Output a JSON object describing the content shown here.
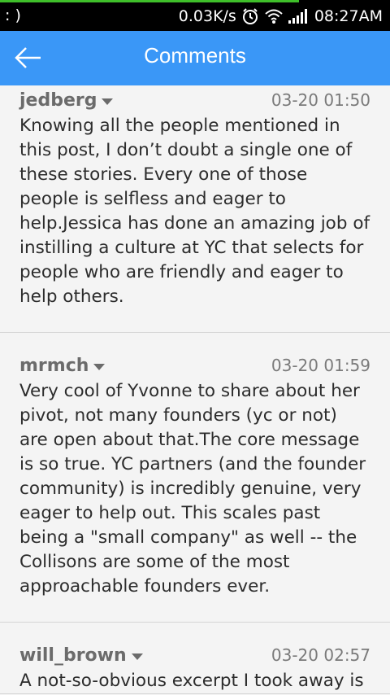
{
  "status": {
    "left": ": )",
    "speed": "0.03K/s",
    "time": "08:27AM"
  },
  "appbar": {
    "title": "Comments"
  },
  "comments": [
    {
      "user": "jedberg",
      "time": "03-20 01:50",
      "text": "Knowing all the people mentioned in this post, I don’t doubt a single one of these stories. Every one of those people is selfless and eager to help.Jessica has done an amazing job of instilling a culture at YC that selects for people who are friendly and eager to help others."
    },
    {
      "user": "mrmch",
      "time": "03-20 01:59",
      "text": "Very cool of Yvonne to share about her pivot, not many founders (yc or not) are open about that.The core message is so true. YC partners (and the founder community) is incredibly genuine, very eager to help out. This scales past being a \"small company\" as well -- the Collisons are some of the most approachable founders ever."
    },
    {
      "user": "will_brown",
      "time": "03-20 02:57",
      "text": "A not-so-obvious excerpt I took away is"
    }
  ]
}
